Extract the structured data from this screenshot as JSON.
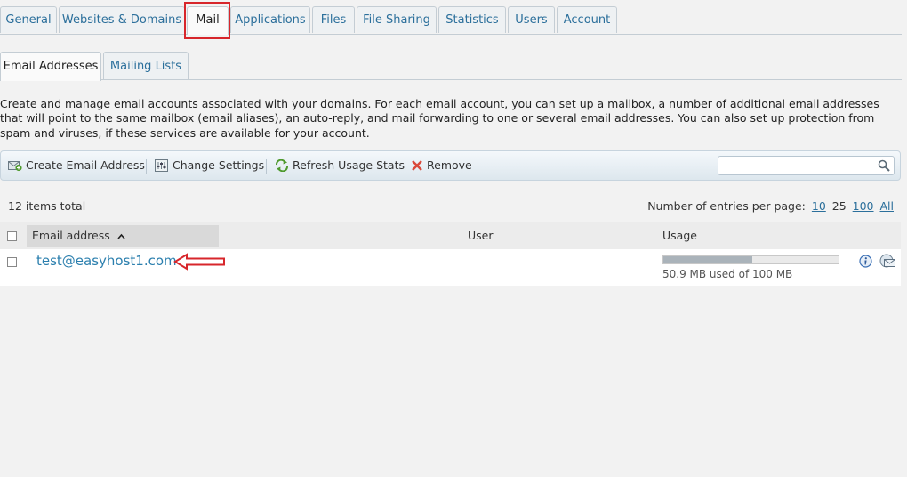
{
  "main_tabs": [
    {
      "label": "General"
    },
    {
      "label": "Websites & Domains"
    },
    {
      "label": "Mail"
    },
    {
      "label": "Applications"
    },
    {
      "label": "Files"
    },
    {
      "label": "File Sharing"
    },
    {
      "label": "Statistics"
    },
    {
      "label": "Users"
    },
    {
      "label": "Account"
    }
  ],
  "active_main_tab": "Mail",
  "sub_tabs": [
    {
      "label": "Email Addresses"
    },
    {
      "label": "Mailing Lists"
    }
  ],
  "description": "Create and manage email accounts associated with your domains. For each email account, you can set up a mailbox, a number of additional email addresses that will point to the same mailbox (email aliases), an auto-reply, and mail forwarding to one or several email addresses. You can also set up protection from spam and viruses, if these services are available for your account.",
  "toolbar": {
    "create_label": "Create Email Address",
    "settings_label": "Change Settings",
    "refresh_label": "Refresh Usage Stats",
    "remove_label": "Remove",
    "search_placeholder": ""
  },
  "list_info": {
    "items_total": "12 items total",
    "entries_label": "Number of entries per page:",
    "entries_options": [
      "10",
      "25",
      "100",
      "All"
    ],
    "entries_selected": "25"
  },
  "table": {
    "columns": [
      "Email address",
      "User",
      "Usage"
    ],
    "rows": [
      {
        "email": "test@easyhost1.com",
        "user": "",
        "usage_text": "50.9 MB used of 100 MB",
        "usage_fraction": 0.509
      }
    ]
  },
  "colors": {
    "link": "#2b6f9b",
    "highlight": "#d7262b"
  }
}
